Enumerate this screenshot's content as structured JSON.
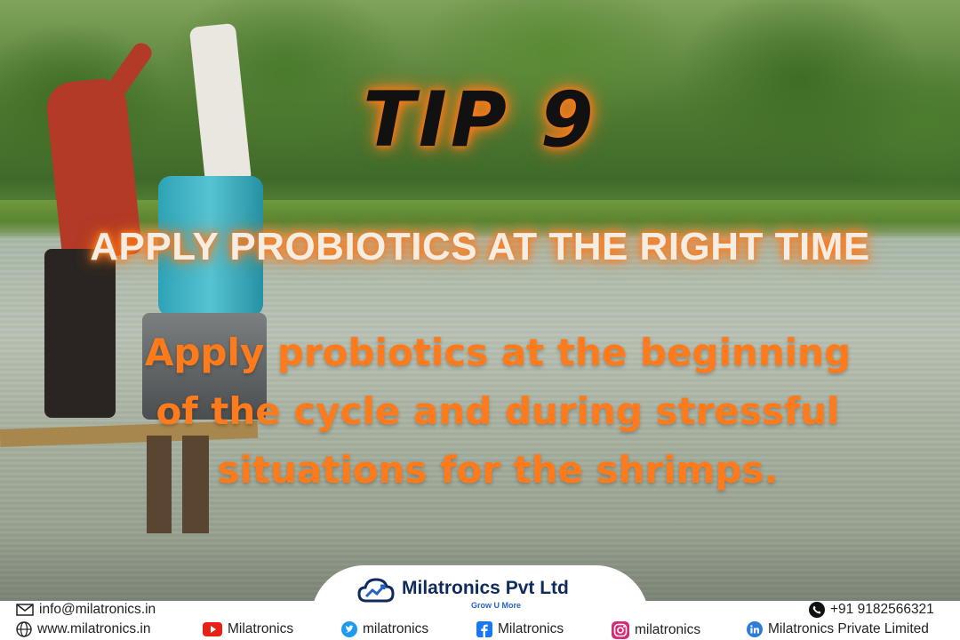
{
  "tip": {
    "title": "TIP 9"
  },
  "headline": "APPLY PROBIOTICS AT THE RIGHT TIME",
  "body": {
    "line1": "Apply probiotics at the beginning",
    "line2": "of the cycle and during stressful",
    "line3": "situations for the shrimps."
  },
  "brand": {
    "name": "Milatronics Pvt Ltd",
    "tagline": "Grow U More"
  },
  "footer": {
    "email": "info@milatronics.in",
    "website": "www.milatronics.in",
    "phone": "+91 9182566321",
    "youtube": "Milatronics",
    "twitter": "milatronics",
    "facebook": "Milatronics",
    "instagram": "milatronics",
    "linkedin": "Milatronics Private Limited"
  },
  "colors": {
    "accent": "#ff7a1a",
    "brand_navy": "#0f2a5c",
    "brand_blue": "#2563c7"
  },
  "icons": [
    "mail-icon",
    "globe-icon",
    "phone-icon",
    "youtube-icon",
    "twitter-icon",
    "facebook-icon",
    "instagram-icon",
    "linkedin-icon",
    "cloud-chart-logo-icon"
  ]
}
